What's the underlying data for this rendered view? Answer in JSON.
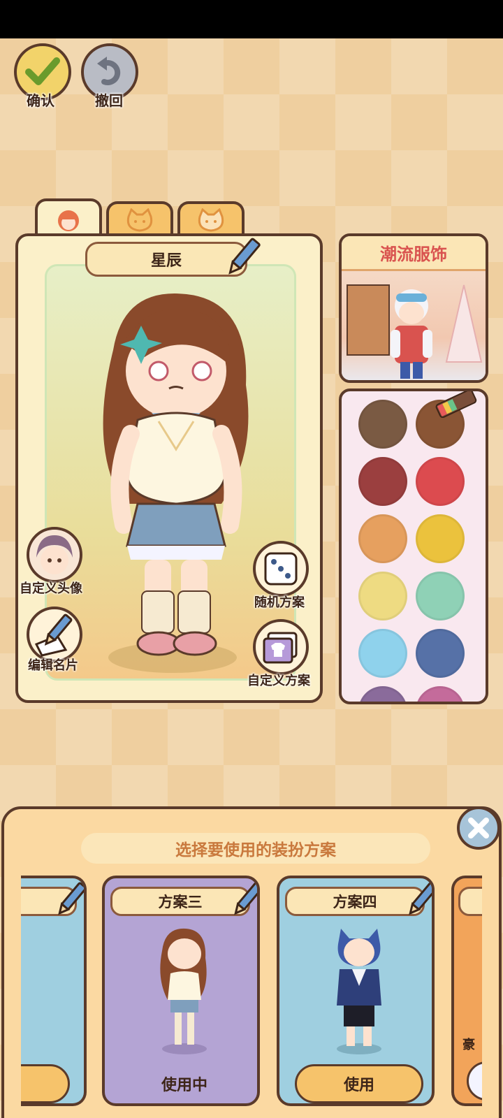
{
  "top_bar": {
    "confirm_label": "确认",
    "undo_label": "撤回"
  },
  "tabs": [
    {
      "icon": "girl-face-icon",
      "active": true
    },
    {
      "icon": "cat-face-icon",
      "active": false
    },
    {
      "icon": "cat-face-icon",
      "active": false
    }
  ],
  "character": {
    "name": "星辰"
  },
  "left_actions": {
    "custom_avatar_label": "自定义头像",
    "edit_card_label": "编辑名片"
  },
  "right_actions": {
    "random_plan_label": "随机方案",
    "custom_plan_label": "自定义方案"
  },
  "trend_panel": {
    "title": "潮流服饰"
  },
  "palette": {
    "colors": [
      "#7a5a43",
      "#8a5535",
      "#9b3f3f",
      "#dc4b4f",
      "#e6a05f",
      "#ebc23d",
      "#eedb82",
      "#8fd1b6",
      "#8fd2ec",
      "#5671a7"
    ]
  },
  "sheet": {
    "title": "选择要使用的装扮方案",
    "plans": [
      {
        "name": "",
        "button": "",
        "state": "partial"
      },
      {
        "name": "方案三",
        "button": "使用中",
        "state": "active"
      },
      {
        "name": "方案四",
        "button": "使用",
        "state": "available"
      },
      {
        "name": "",
        "button": "",
        "side_text": "豪",
        "state": "partial"
      }
    ]
  }
}
